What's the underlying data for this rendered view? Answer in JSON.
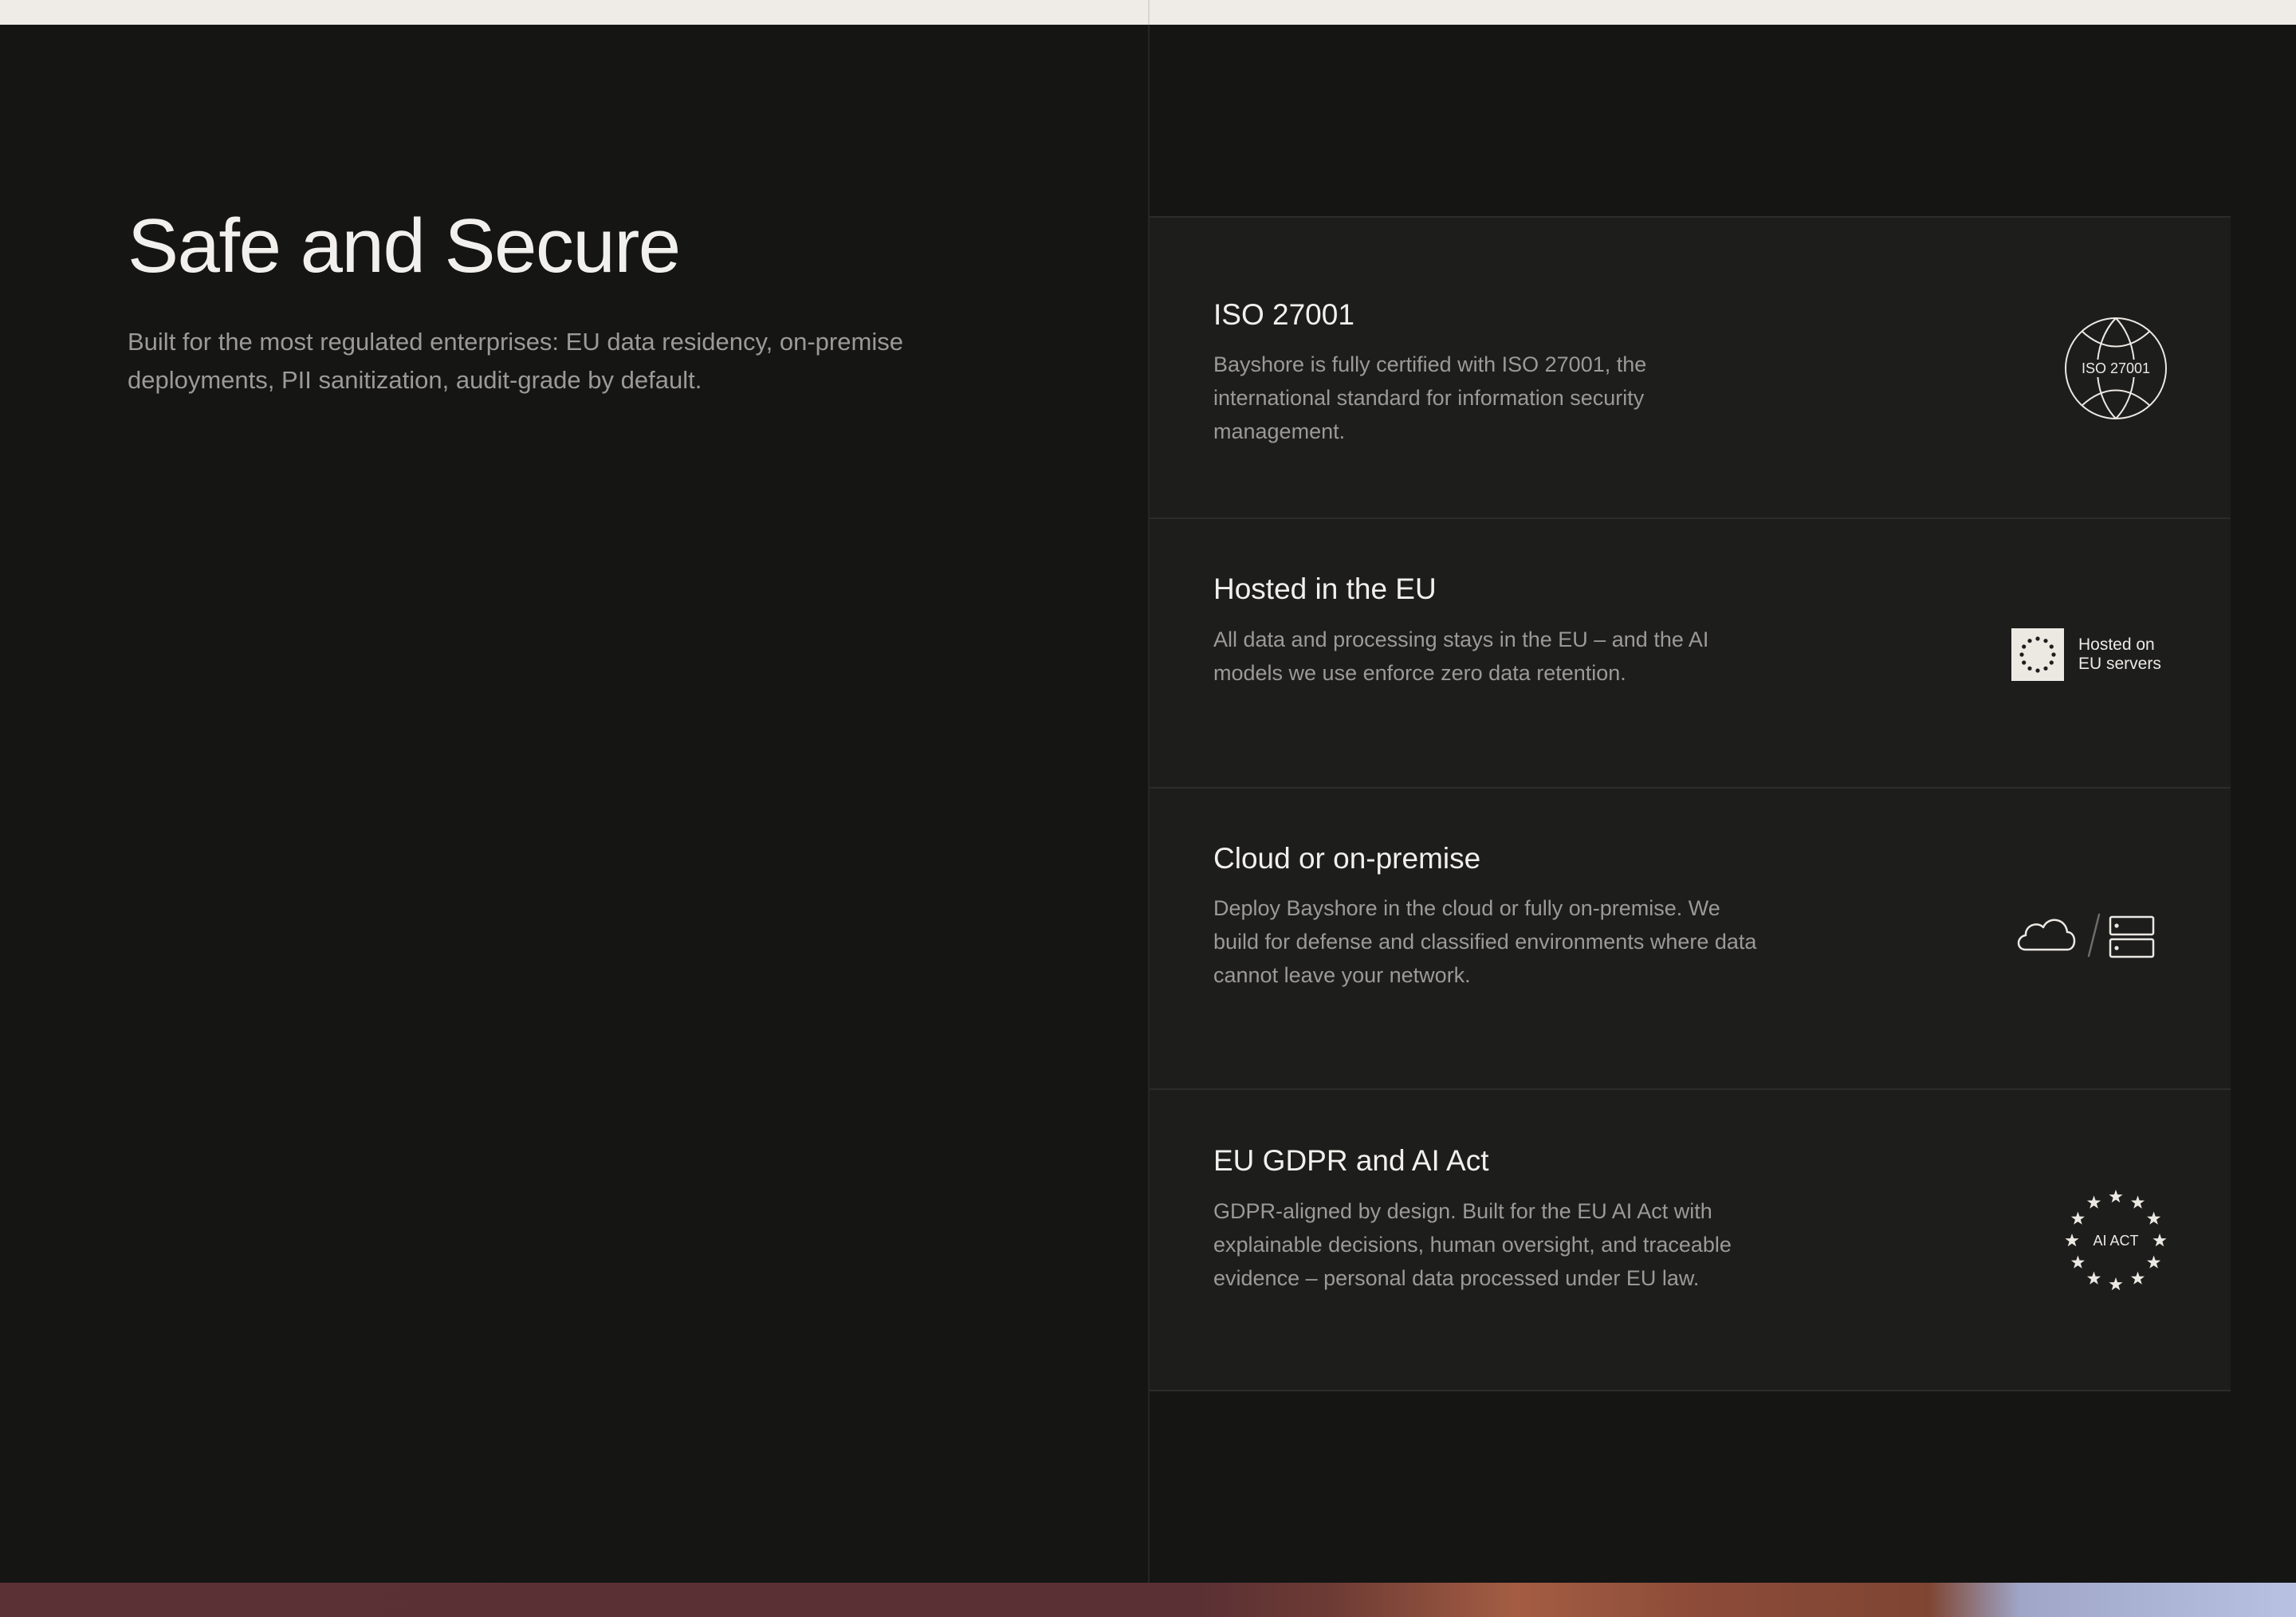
{
  "section": {
    "title": "Safe and Secure",
    "intro": "Built for the most regulated enterprises: EU data residency, on-premise deployments, PII sanitization, audit-grade by default."
  },
  "cards": [
    {
      "title": "ISO 27001",
      "text": "Bayshore is fully certified with ISO 27001, the international standard for information security management.",
      "icon": "iso-globe-icon",
      "icon_label": "ISO 27001"
    },
    {
      "title": "Hosted in the EU",
      "text": "All data and processing stays in the EU – and the AI models we use enforce zero data retention.",
      "icon": "eu-flag-icon",
      "icon_label_line1": "Hosted on",
      "icon_label_line2": "EU servers"
    },
    {
      "title": "Cloud or on-premise",
      "text": "Deploy Bayshore in the cloud or fully on-premise. We build for defense and classified environments where data cannot leave your network.",
      "icon": "cloud-server-icon"
    },
    {
      "title": "EU GDPR and AI Act",
      "text": "GDPR-aligned by design. Built for the EU AI Act with explainable decisions, human oversight, and traceable evidence – personal data processed under EU law.",
      "icon": "ai-act-stars-icon",
      "icon_label": "AI ACT"
    }
  ],
  "colors": {
    "background": "#151514",
    "card_background": "#1d1d1c",
    "top_bar": "#efece7",
    "heading": "#f2f0ec",
    "body_text": "#9c9a96"
  }
}
